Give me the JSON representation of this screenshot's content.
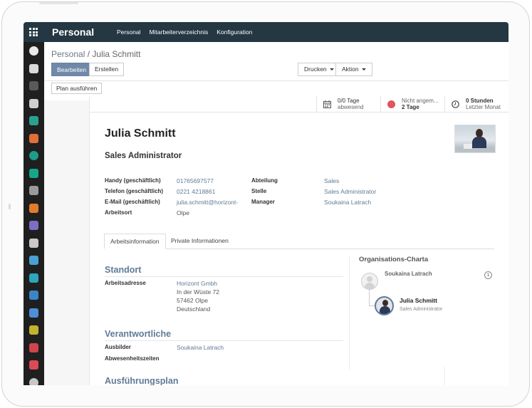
{
  "app": {
    "title": "Personal",
    "menu": [
      "Personal",
      "Mitarbeiterverzeichnis",
      "Konfiguration"
    ]
  },
  "breadcrumb": {
    "parent": "Personal",
    "separator": "/",
    "current": "Julia Schmitt"
  },
  "toolbar": {
    "edit_label": "Bearbeiten",
    "create_label": "Erstellen",
    "print_label": "Drucken",
    "action_label": "Aktion",
    "plan_label": "Plan ausführen"
  },
  "smart_buttons": [
    {
      "icon": "calendar-icon",
      "line1": "0/0 Tage",
      "line2": "abwesend"
    },
    {
      "icon": "status-dot-icon",
      "line1": "Nicht angem...",
      "line2": "2 Tage",
      "color": "#e0555f"
    },
    {
      "icon": "clock-icon",
      "line1": "0 Stunden",
      "line2": "Letzter Monat"
    }
  ],
  "employee": {
    "name": "Julia Schmitt",
    "job_title": "Sales Administrator"
  },
  "fields_left": [
    {
      "label": "Handy (geschäftlich)",
      "value": "01765697577"
    },
    {
      "label": "Telefon (geschäftlich)",
      "value": "0221 4218861"
    },
    {
      "label": "E-Mail (geschäftlich)",
      "value": "julia.schmitt@horizont-"
    },
    {
      "label": "Arbeitsort",
      "value": "Olpe"
    }
  ],
  "fields_right": [
    {
      "label": "Abteilung",
      "value": "Sales"
    },
    {
      "label": "Stelle",
      "value": "Sales Administrator"
    },
    {
      "label": "Manager",
      "value": "Soukaina Latrach"
    }
  ],
  "tabs": [
    "Arbeitsinformation",
    "Private Informationen"
  ],
  "standort": {
    "title": "Standort",
    "label": "Arbeitsadresse",
    "lines": [
      "Horizont Gmbh",
      "In der Wüste 72",
      "57462 Olpe",
      "Deutschland"
    ]
  },
  "verantwortliche": {
    "title": "Verantwortliche",
    "ausbilder_label": "Ausbilder",
    "ausbilder_value": "Soukaina Latrach",
    "abwesenheit_label": "Abwesenheitszeiten"
  },
  "ausfuehrungsplan": {
    "title": "Ausführungsplan"
  },
  "org_chart": {
    "title": "Organisations-Charta",
    "manager_name": "Soukaina Latrach",
    "manager_count": "1",
    "employee_name": "Julia Schmitt",
    "employee_job": "Sales Administrator"
  },
  "colors": {
    "topbar": "#243742",
    "rail": "#1f1f1f",
    "primary_button": "#6f8aa8",
    "link": "#5f7b95"
  }
}
